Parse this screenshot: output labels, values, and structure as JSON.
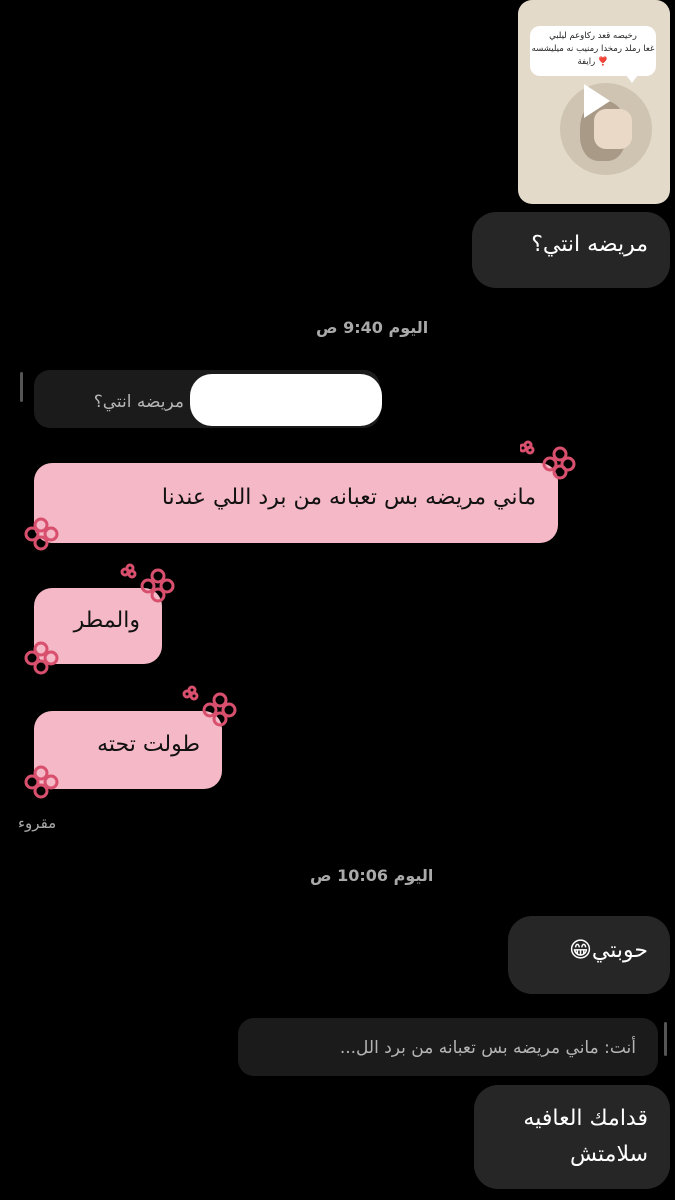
{
  "story": {
    "caption_line1": "رخيصه قعد ركاوعم ليلبي",
    "caption_line2": "غعا رملد رمخدا رمنيب نه ميليشسه",
    "caption_line3": "❣️ رايفة"
  },
  "messages": {
    "m1": "مريضه انتي؟",
    "ts1": "اليوم 9:40 ص",
    "reply1_quote": "مريضه انتي؟",
    "m2": "ماني مريضه بس تعبانه من برد اللي عندنا",
    "m3": "والمطر",
    "m4": "طولت تحته",
    "read": "مقروء",
    "ts2": "اليوم 10:06 ص",
    "m5": "حوبتي😁",
    "reply2_quote": "أنت: ماني مريضه بس تعبانه من برد الل...",
    "m6_line1": "قدامك العافيه",
    "m6_line2": "سلامتش"
  },
  "colors": {
    "background": "#000000",
    "received_bubble": "#262626",
    "sent_bubble": "#f4b8c6",
    "flower": "#d9506e"
  }
}
